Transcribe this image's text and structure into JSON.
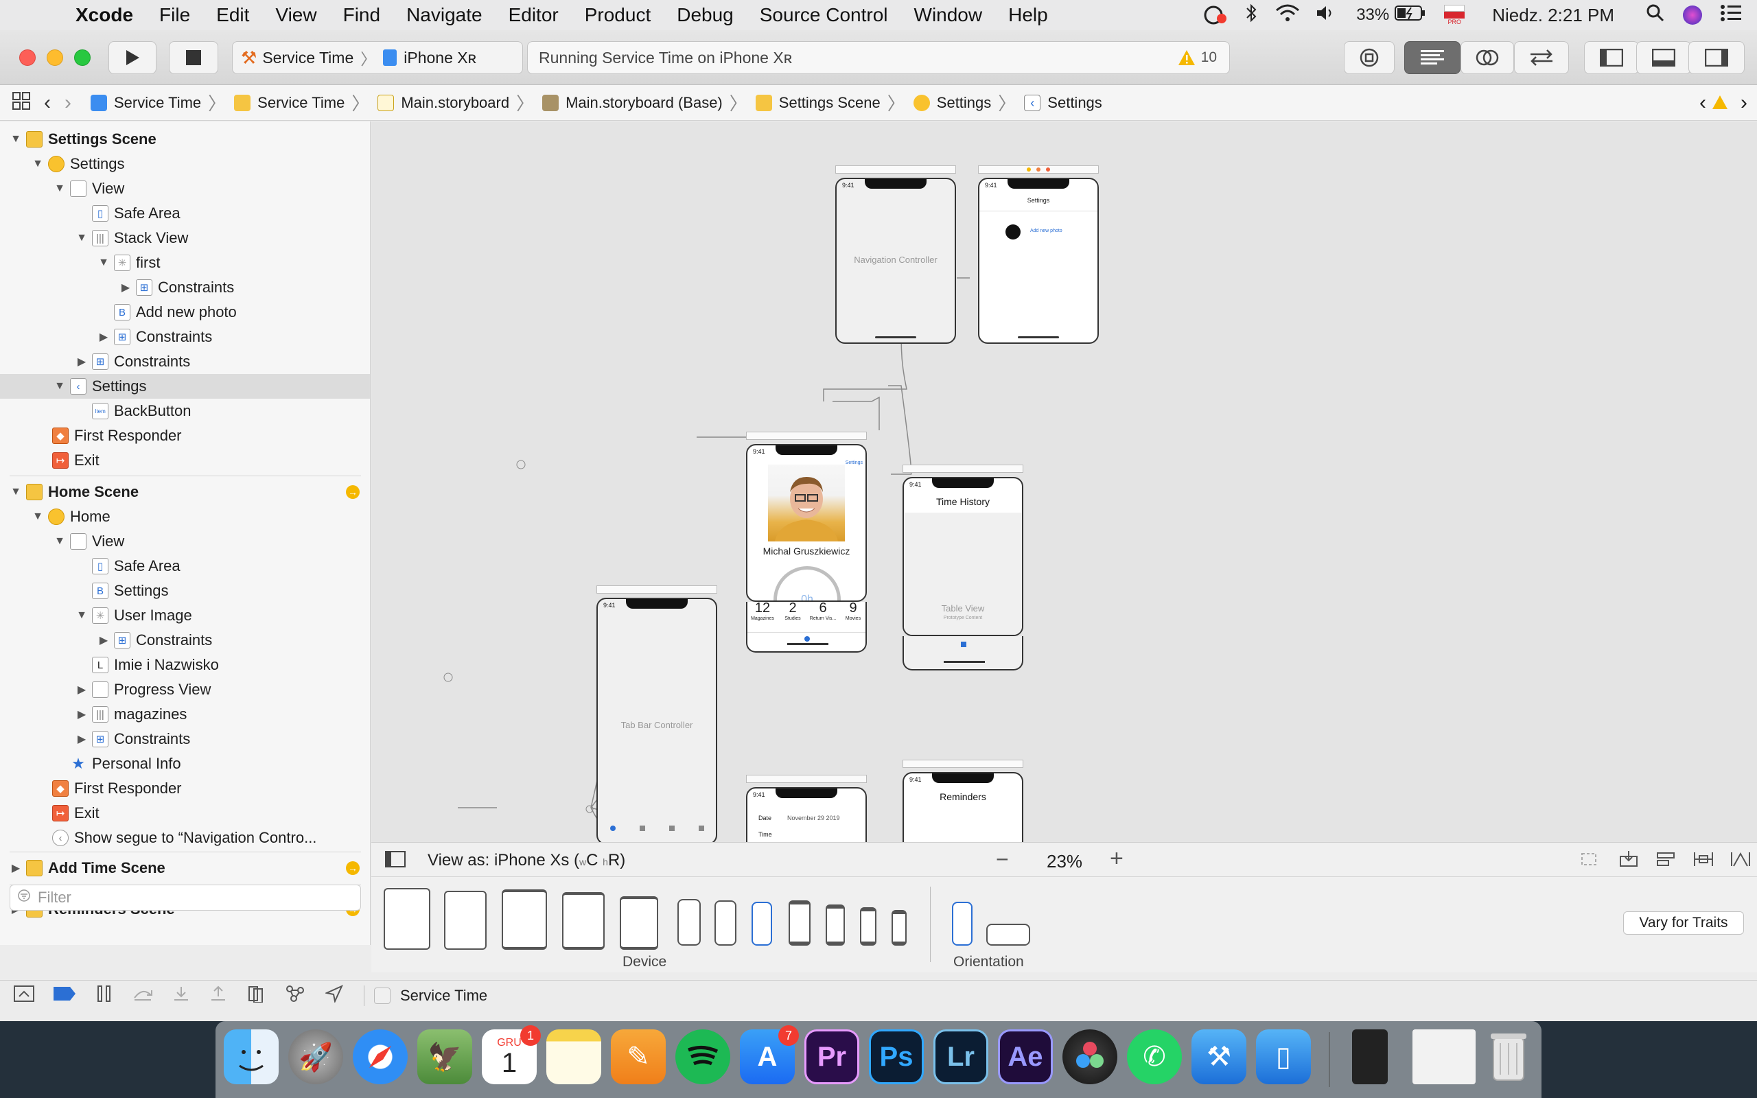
{
  "menubar": {
    "app": "Xcode",
    "items": [
      "File",
      "Edit",
      "View",
      "Find",
      "Navigate",
      "Editor",
      "Product",
      "Debug",
      "Source Control",
      "Window",
      "Help"
    ],
    "battery": "33%",
    "flag_label": "PRO",
    "clock": "Niedz. 2:21 PM"
  },
  "toolbar": {
    "scheme": "Service Time",
    "device": "iPhone Xʀ",
    "activity": "Running Service Time on iPhone Xʀ",
    "warnings": "10"
  },
  "pathbar": {
    "crumbs": [
      "Service Time",
      "Service Time",
      "Main.storyboard",
      "Main.storyboard (Base)",
      "Settings Scene",
      "Settings",
      "Settings"
    ]
  },
  "navigator": {
    "rows": [
      {
        "label": "Settings Scene"
      },
      {
        "label": "Settings"
      },
      {
        "label": "View"
      },
      {
        "label": "Safe Area"
      },
      {
        "label": "Stack View"
      },
      {
        "label": "first"
      },
      {
        "label": "Constraints"
      },
      {
        "label": "Add new photo",
        "icon": "B"
      },
      {
        "label": "Constraints"
      },
      {
        "label": "Constraints"
      },
      {
        "label": "Settings"
      },
      {
        "label": "BackButton",
        "icon": "Item"
      },
      {
        "label": "First Responder"
      },
      {
        "label": "Exit"
      },
      {
        "label": "Home Scene"
      },
      {
        "label": "Home"
      },
      {
        "label": "View"
      },
      {
        "label": "Safe Area"
      },
      {
        "label": "Settings",
        "icon": "B"
      },
      {
        "label": "User Image"
      },
      {
        "label": "Constraints"
      },
      {
        "label": "Imie i Nazwisko",
        "icon": "L"
      },
      {
        "label": "Progress View"
      },
      {
        "label": "magazines"
      },
      {
        "label": "Constraints"
      },
      {
        "label": "Personal Info"
      },
      {
        "label": "First Responder"
      },
      {
        "label": "Exit"
      },
      {
        "label": "Show segue to “Navigation Contro..."
      },
      {
        "label": "Add Time Scene"
      },
      {
        "label": "Reminders Scene"
      }
    ],
    "filter_placeholder": "Filter"
  },
  "canvas": {
    "nav_controller_label": "Navigation Controller",
    "settings_title": "Settings",
    "settings_add_photo": "Add new photo",
    "home_settings_link": "Settings",
    "home_name": "Michal Gruszkiewicz",
    "home_progress": "0h",
    "home_stats": [
      {
        "value": "12",
        "label": "Magazines"
      },
      {
        "value": "2",
        "label": "Studies"
      },
      {
        "value": "6",
        "label": "Return Vis..."
      },
      {
        "value": "9",
        "label": "Movies"
      }
    ],
    "tabbar_label": "Tab Bar Controller",
    "time_history_title": "Time History",
    "table_view_label": "Table View",
    "table_view_sub": "Prototype Content",
    "reminders_title": "Reminders",
    "addtime_date_label": "Date",
    "addtime_date_value": "November  29  2019",
    "addtime_time_label": "Time",
    "status_time": "9:41"
  },
  "viewas": {
    "label": "View as: iPhone Xs (",
    "w": "w",
    "c": "C",
    "h": "h",
    "r": "R",
    "close": ")",
    "zoom": "23%"
  },
  "devicebar": {
    "device_label": "Device",
    "orientation_label": "Orientation",
    "vary_button": "Vary for Traits"
  },
  "statusbar": {
    "target": "Service Time"
  },
  "dock": {
    "calendar_month": "GRU",
    "calendar_day": "1",
    "calendar_badge": "1",
    "appstore_badge": "7",
    "apps": [
      "Finder",
      "Launchpad",
      "Safari",
      "Preview",
      "Calendar",
      "Notes",
      "Pages",
      "Spotify",
      "App Store",
      "Pr",
      "Ps",
      "Lr",
      "Ae",
      "DaVinci",
      "WhatsApp",
      "Xcode",
      "Simulator"
    ]
  },
  "colors": {
    "accent": "#2b6fd4",
    "warning": "#f5b800"
  }
}
